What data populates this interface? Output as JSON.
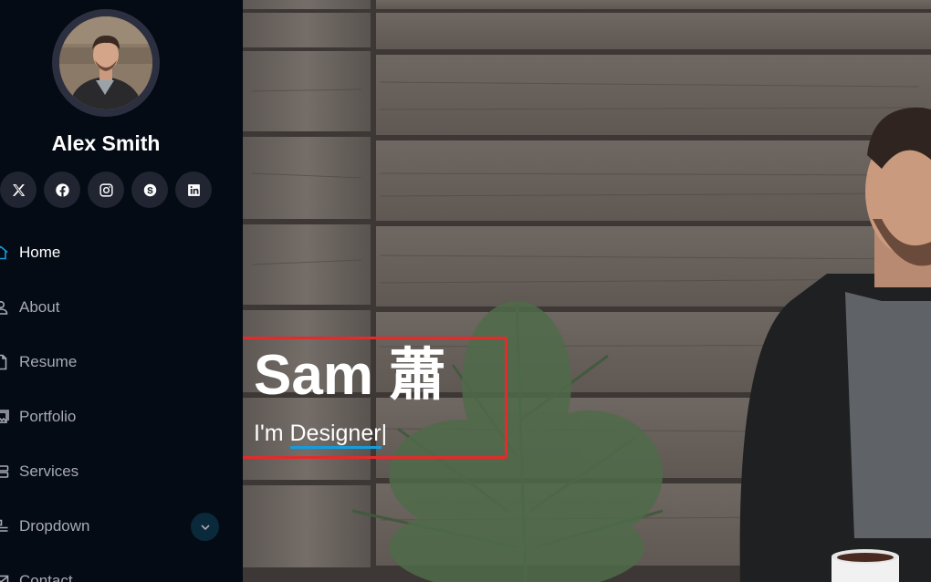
{
  "profile": {
    "name": "Alex Smith"
  },
  "social": [
    {
      "icon": "x-twitter-icon"
    },
    {
      "icon": "facebook-icon"
    },
    {
      "icon": "instagram-icon"
    },
    {
      "icon": "skype-icon"
    },
    {
      "icon": "linkedin-icon"
    }
  ],
  "nav": {
    "items": [
      {
        "label": "Home",
        "icon": "house-icon",
        "active": true
      },
      {
        "label": "About",
        "icon": "person-icon"
      },
      {
        "label": "Resume",
        "icon": "file-icon"
      },
      {
        "label": "Portfolio",
        "icon": "images-icon"
      },
      {
        "label": "Services",
        "icon": "hdd-stack-icon"
      },
      {
        "label": "Dropdown",
        "icon": "menu-icon"
      },
      {
        "label": "Contact",
        "icon": "envelope-icon"
      }
    ]
  },
  "hero": {
    "title": "Sam 蕭",
    "prefix": "I'm ",
    "typed": "Designer",
    "cursor": "|"
  },
  "colors": {
    "accent": "#149ddd",
    "sidebar_bg": "#040b14",
    "highlight": "#e32b2b"
  }
}
